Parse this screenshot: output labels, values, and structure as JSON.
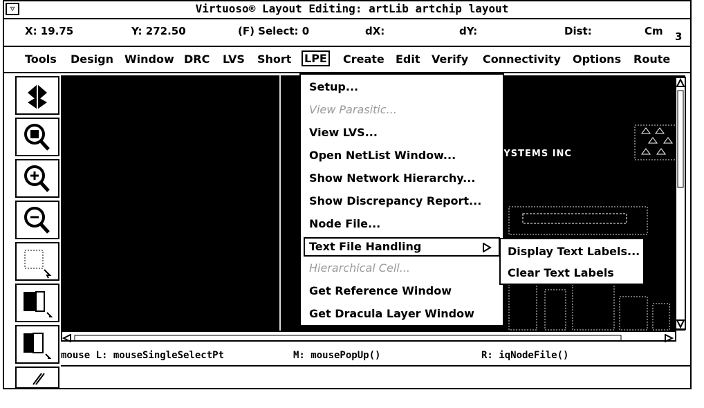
{
  "window": {
    "title": "Virtuoso® Layout Editing: artLib artchip layout",
    "control_glyph": "▽"
  },
  "status": {
    "x": "X: 19.75",
    "y": "Y: 272.50",
    "select": "(F) Select: 0",
    "dx": "dX:",
    "dy": "dY:",
    "dist": "Dist:",
    "cmd": "Cm",
    "cmd_num": "3"
  },
  "menubar": [
    "Tools",
    "Design",
    "Window",
    "DRC",
    "LVS",
    "Short",
    "LPE",
    "Create",
    "Edit",
    "Verify",
    "Connectivity",
    "Options",
    "Route"
  ],
  "lpe_menu": {
    "items": [
      {
        "label": "Setup...",
        "disabled": false
      },
      {
        "label": "View Parasitic...",
        "disabled": true
      },
      {
        "label": "View LVS...",
        "disabled": false
      },
      {
        "label": "Open NetList Window...",
        "disabled": false
      },
      {
        "label": "Show Network Hierarchy...",
        "disabled": false
      },
      {
        "label": "Show Discrepancy Report...",
        "disabled": false
      },
      {
        "label": "Node File...",
        "disabled": false
      },
      {
        "label": "Text File Handling",
        "disabled": false,
        "submenu": true
      },
      {
        "label": "Hierarchical Cell...",
        "disabled": true
      },
      {
        "label": "Get Reference Window",
        "disabled": false
      },
      {
        "label": "Get Dracula Layer Window",
        "disabled": false
      }
    ]
  },
  "submenu": {
    "items": [
      "Display Text Labels...",
      "Clear Text Labels"
    ]
  },
  "canvas_text": {
    "company": "SYSTEMS INC"
  },
  "mouse": {
    "left": "mouse L: mouseSingleSelectPt",
    "middle": "M: mousePopUp()",
    "right": "R: iqNodeFile()"
  },
  "toolbar_icons": [
    "layers-icon",
    "zoom-fit-icon",
    "zoom-in-icon",
    "zoom-out-icon",
    "select-box-icon",
    "create-rect-icon",
    "stretch-icon",
    "pen-icon"
  ]
}
